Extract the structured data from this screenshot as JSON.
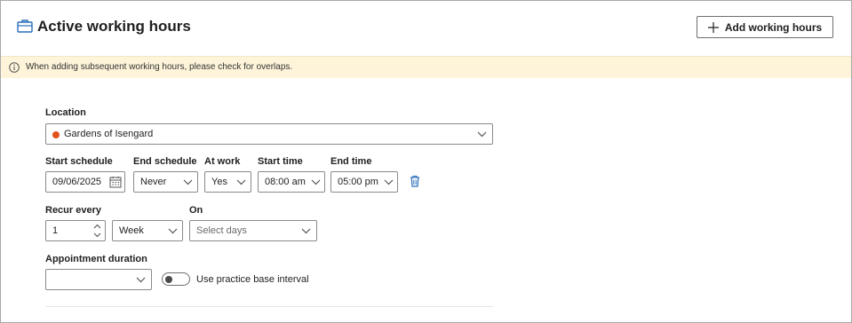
{
  "header": {
    "title": "Active working hours",
    "add_button_label": "Add working hours"
  },
  "banner": {
    "text": "When adding subsequent working hours, please check for overlaps."
  },
  "form": {
    "location": {
      "label": "Location",
      "value": "Gardens of Isengard",
      "dot_color": "#e0531d"
    },
    "start_schedule": {
      "label": "Start schedule",
      "value": "09/06/2025"
    },
    "end_schedule": {
      "label": "End schedule",
      "value": "Never"
    },
    "at_work": {
      "label": "At work",
      "value": "Yes"
    },
    "start_time": {
      "label": "Start time",
      "value": "08:00 am"
    },
    "end_time": {
      "label": "End time",
      "value": "05:00 pm"
    },
    "recur_every": {
      "label": "Recur every",
      "value": "1"
    },
    "recur_unit": {
      "value": "Week"
    },
    "on": {
      "label": "On",
      "placeholder": "Select days"
    },
    "appointment_duration": {
      "label": "Appointment duration",
      "value": ""
    },
    "use_base_interval": {
      "label": "Use practice base interval",
      "checked": false
    }
  },
  "colors": {
    "accent": "#2a6ebb",
    "banner_bg": "#fdf4d9",
    "location_dot": "#e0531d"
  }
}
